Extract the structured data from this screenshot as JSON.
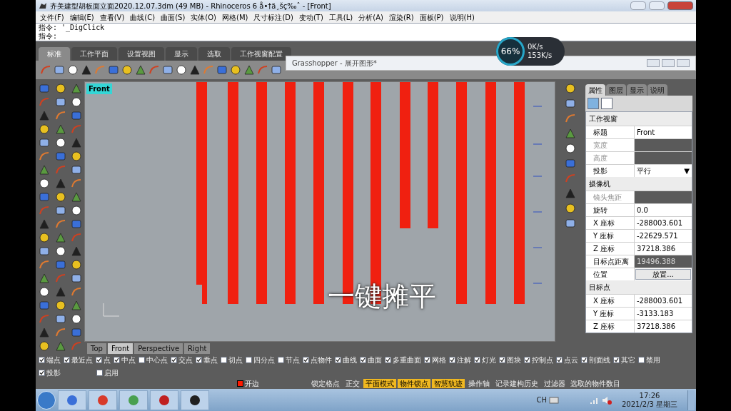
{
  "title_bar": {
    "title": "齐美建型胡板面立面2020.12.07.3dm (49 MB) - Rhinoceros 6 å•†ä¸šç‰ˆ - [Front]"
  },
  "menu": [
    "文件(F)",
    "编辑(E)",
    "查看(V)",
    "曲线(C)",
    "曲面(S)",
    "实体(O)",
    "网格(M)",
    "尺寸标注(D)",
    "变动(T)",
    "工具(L)",
    "分析(A)",
    "渲染(R)",
    "面板(P)",
    "说明(H)"
  ],
  "command_lines": [
    "指令: '_DigClick",
    "指令:"
  ],
  "toolbar_tabs": [
    {
      "label": "标准",
      "selected": true
    },
    {
      "label": "工作平面",
      "selected": false
    },
    {
      "label": "设置视图",
      "selected": false
    },
    {
      "label": "显示",
      "selected": false
    },
    {
      "label": "选取",
      "selected": false
    },
    {
      "label": "工作视窗配置",
      "selected": false
    }
  ],
  "grasshopper_window": {
    "title": "Grasshopper - 展开图形*"
  },
  "speed_widget": {
    "percent": "66%",
    "upload": "0K/s",
    "download": "153K/s"
  },
  "viewport": {
    "label": "Front",
    "caption": "一键摊平"
  },
  "viewport_tabs": [
    {
      "label": "Top",
      "selected": false
    },
    {
      "label": "Front",
      "selected": true
    },
    {
      "label": "Perspective",
      "selected": false
    },
    {
      "label": "Right",
      "selected": false
    }
  ],
  "panel_tabs": [
    {
      "label": "属性",
      "selected": true
    },
    {
      "label": "图层",
      "selected": false
    },
    {
      "label": "显示",
      "selected": false
    },
    {
      "label": "说明",
      "selected": false
    }
  ],
  "properties": [
    {
      "title": "工作视窗",
      "rows": [
        {
          "label": "标题",
          "value": "Front",
          "kind": "field"
        },
        {
          "label": "宽度",
          "kind": "disabled"
        },
        {
          "label": "高度",
          "kind": "disabled"
        },
        {
          "label": "投影",
          "value": "平行",
          "caret": "▼",
          "kind": "dropdown"
        }
      ]
    },
    {
      "title": "摄像机",
      "rows": [
        {
          "label": "镜头焦距",
          "kind": "disabled"
        },
        {
          "label": "旋转",
          "value": "0.0",
          "kind": "field"
        },
        {
          "label": "X 座标",
          "value": "-288003.601",
          "kind": "field"
        },
        {
          "label": "Y 座标",
          "value": "-22629.571",
          "kind": "field"
        },
        {
          "label": "Z 座标",
          "value": "37218.386",
          "kind": "field"
        },
        {
          "label": "目标点距离",
          "value": "19496.388",
          "kind": "readonly"
        },
        {
          "label": "位置",
          "value": "放置...",
          "kind": "button"
        }
      ]
    },
    {
      "title": "目标点",
      "rows": [
        {
          "label": "X 座标",
          "value": "-288003.601",
          "kind": "field"
        },
        {
          "label": "Y 座标",
          "value": "-3133.183",
          "kind": "field"
        },
        {
          "label": "Z 座标",
          "value": "37218.386",
          "kind": "field"
        }
      ]
    }
  ],
  "osnaps": [
    {
      "label": "端点",
      "checked": true
    },
    {
      "label": "最近点",
      "checked": true
    },
    {
      "label": "点",
      "checked": true
    },
    {
      "label": "中点",
      "checked": true
    },
    {
      "label": "中心点",
      "checked": false
    },
    {
      "label": "交点",
      "checked": true
    },
    {
      "label": "垂点",
      "checked": true
    },
    {
      "label": "切点",
      "checked": false
    },
    {
      "label": "四分点",
      "checked": false
    },
    {
      "label": "节点",
      "checked": false
    },
    {
      "label": "点物件",
      "checked": true
    },
    {
      "label": "曲线",
      "checked": true
    },
    {
      "label": "曲面",
      "checked": true
    },
    {
      "label": "多重曲面",
      "checked": true
    },
    {
      "label": "网格",
      "checked": true
    },
    {
      "label": "注解",
      "checked": true
    },
    {
      "label": "灯光",
      "checked": true
    },
    {
      "label": "图块",
      "checked": true
    },
    {
      "label": "控制点",
      "checked": true
    },
    {
      "label": "点云",
      "checked": true
    },
    {
      "label": "剖面线",
      "checked": true
    },
    {
      "label": "其它",
      "checked": true
    },
    {
      "label": "禁用",
      "checked": false
    }
  ],
  "osnaps_row2": [
    {
      "label": "投影",
      "checked": true
    },
    {
      "label": "启用",
      "checked": false
    }
  ],
  "status_bar": {
    "layer": {
      "name": "开边",
      "color": "#ff1a00"
    },
    "toggles": [
      {
        "label": "锁定格点",
        "on": false
      },
      {
        "label": "正交",
        "on": false
      },
      {
        "label": "平面模式",
        "on": true
      },
      {
        "label": "物件锁点",
        "on": true
      },
      {
        "label": "智慧轨迹",
        "on": true
      },
      {
        "label": "操作轴",
        "on": false
      },
      {
        "label": "记录建构历史",
        "on": false
      },
      {
        "label": "过滤器",
        "on": false
      }
    ],
    "info": "选取的物件数目"
  },
  "taskbar": {
    "language": "CH",
    "time": "17:26",
    "date": "2021/2/3 星期三"
  }
}
